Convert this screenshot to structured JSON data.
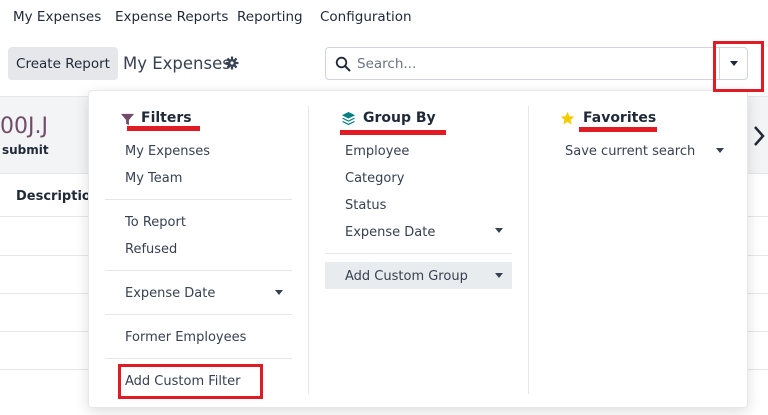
{
  "topnav": {
    "items": [
      "My Expenses",
      "Expense Reports",
      "Reporting",
      "Configuration"
    ]
  },
  "controlbar": {
    "create_label": "Create Report",
    "title": "My Expenses"
  },
  "search": {
    "placeholder": "Search..."
  },
  "background": {
    "amount_text": "00J.J",
    "submit_label": "submit",
    "description_header": "Description"
  },
  "panel": {
    "filters": {
      "title": "Filters",
      "items": [
        "My Expenses",
        "My Team",
        "To Report",
        "Refused",
        "Expense Date",
        "Former Employees",
        "Add Custom Filter"
      ]
    },
    "groupby": {
      "title": "Group By",
      "items": [
        "Employee",
        "Category",
        "Status",
        "Expense Date",
        "Add Custom Group"
      ]
    },
    "favorites": {
      "title": "Favorites",
      "items": [
        "Save current search"
      ]
    }
  },
  "colors": {
    "filter_icon": "#714b67",
    "groupby_icon": "#017e84",
    "favorites_icon": "#f3cc00",
    "annotation": "#e01b24"
  }
}
